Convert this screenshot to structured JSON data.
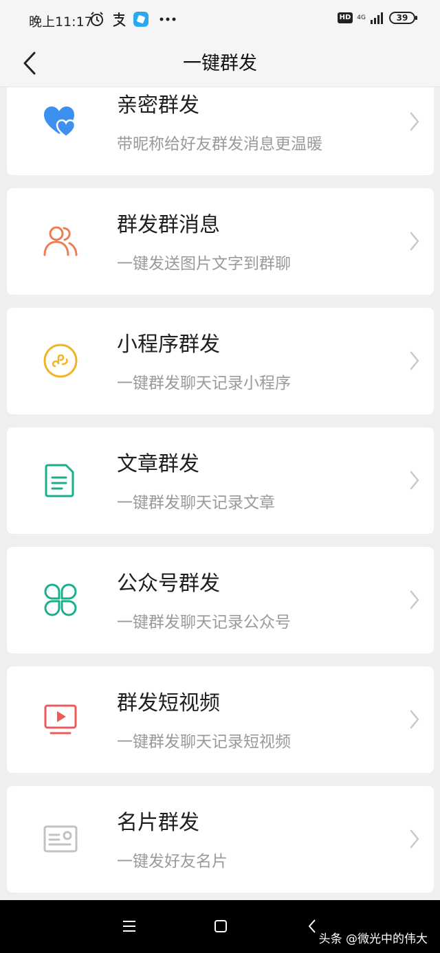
{
  "status_bar": {
    "time": "晚上11:17",
    "hd_label": "HD",
    "network_label": "4G",
    "battery_level": "39"
  },
  "nav": {
    "title": "一键群发"
  },
  "items": [
    {
      "title": "亲密群发",
      "subtitle": "带昵称给好友群发消息更温暖",
      "icon": "hearts-icon",
      "color": "#3d8ff0"
    },
    {
      "title": "群发群消息",
      "subtitle": "一键发送图片文字到群聊",
      "icon": "group-users-icon",
      "color": "#f07b52"
    },
    {
      "title": "小程序群发",
      "subtitle": "一键群发聊天记录小程序",
      "icon": "mini-program-icon",
      "color": "#f0b429"
    },
    {
      "title": "文章群发",
      "subtitle": "一键群发聊天记录文章",
      "icon": "article-icon",
      "color": "#1aae8c"
    },
    {
      "title": "公众号群发",
      "subtitle": "一键群发聊天记录公众号",
      "icon": "clover-icon",
      "color": "#1aae8c"
    },
    {
      "title": "群发短视频",
      "subtitle": "一键群发聊天记录短视频",
      "icon": "video-icon",
      "color": "#ee5a5a"
    },
    {
      "title": "名片群发",
      "subtitle": "一键发好友名片",
      "icon": "business-card-icon",
      "color": "#c2c2c2"
    }
  ],
  "watermark": "头条 @微光中的伟大"
}
